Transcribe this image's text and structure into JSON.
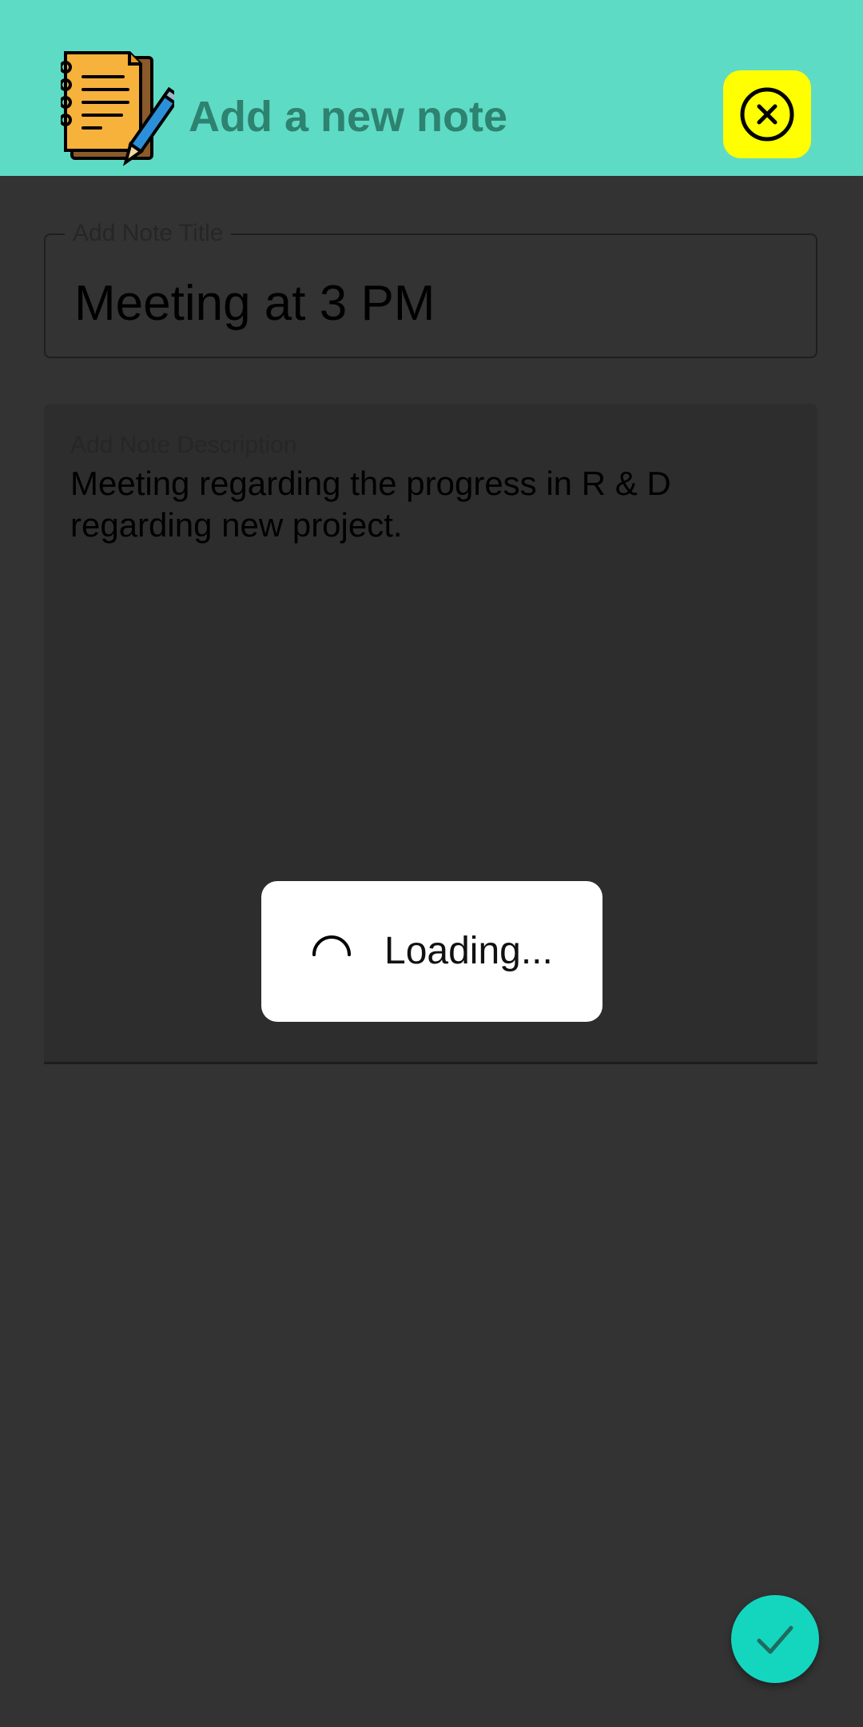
{
  "header": {
    "title": "Add a new note",
    "icon": "notebook-pencil-icon",
    "close_icon": "close-circle-icon",
    "colors": {
      "background": "#5EDBC5",
      "title": "#2E8270",
      "close_button": "#FFFF00"
    }
  },
  "form": {
    "title_field": {
      "label": "Add Note Title",
      "value": "Meeting at 3 PM"
    },
    "description_field": {
      "label": "Add Note Description",
      "value": "Meeting regarding the progress in R & D regarding new project."
    }
  },
  "loading_dialog": {
    "text": "Loading...",
    "icon": "spinner-icon"
  },
  "fab": {
    "icon": "check-icon",
    "color": "#14D6BF"
  }
}
